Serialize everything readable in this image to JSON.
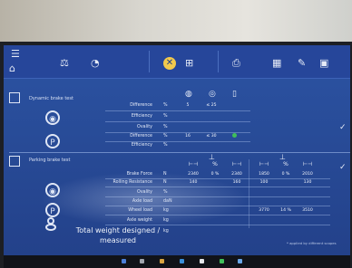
{
  "toolbar": {
    "icons": [
      "scale-icon",
      "gauge-icon",
      "close-circle-icon",
      "axle-icon",
      "printer-icon",
      "grid-icon",
      "tools-icon",
      "save-icon"
    ]
  },
  "sections": {
    "top_title": "Dynamic brake test",
    "mid_title": "Parking brake test"
  },
  "rows": {
    "difference": "Difference",
    "efficiency": "Efficiency",
    "ovality": "Ovality",
    "difference2": "Difference",
    "efficiency2": "Efficiency",
    "brake_force": "Brake Force",
    "rolling_resistance": "Rolling Resistance",
    "ovality2": "Ovality",
    "axle_load": "Axle load",
    "wheel_load": "Wheel load",
    "axle_weight": "Axle weight"
  },
  "units": {
    "percent": "%",
    "newton": "N",
    "dan": "daN",
    "kg": "kg"
  },
  "values": {
    "top_diff_a": "5",
    "top_diff_b": "≤ 25",
    "mid_diff_a": "16",
    "mid_diff_b": "≤ 30",
    "bf_1": "2340",
    "bf_pct": "0 %",
    "bf_2": "2340",
    "bf_3": "1850",
    "bf_pct2": "0 %",
    "bf_4": "2010",
    "rr_1": "140",
    "rr_2": "160",
    "rr_3": "100",
    "rr_4": "130",
    "wl_1": "3770",
    "wl_pct": "14 %",
    "wl_2": "3510"
  },
  "total": {
    "label_line1": "Total weight designed /",
    "label_line2": "measured",
    "unit": "kg"
  },
  "footnote": "* applied by different scopes"
}
